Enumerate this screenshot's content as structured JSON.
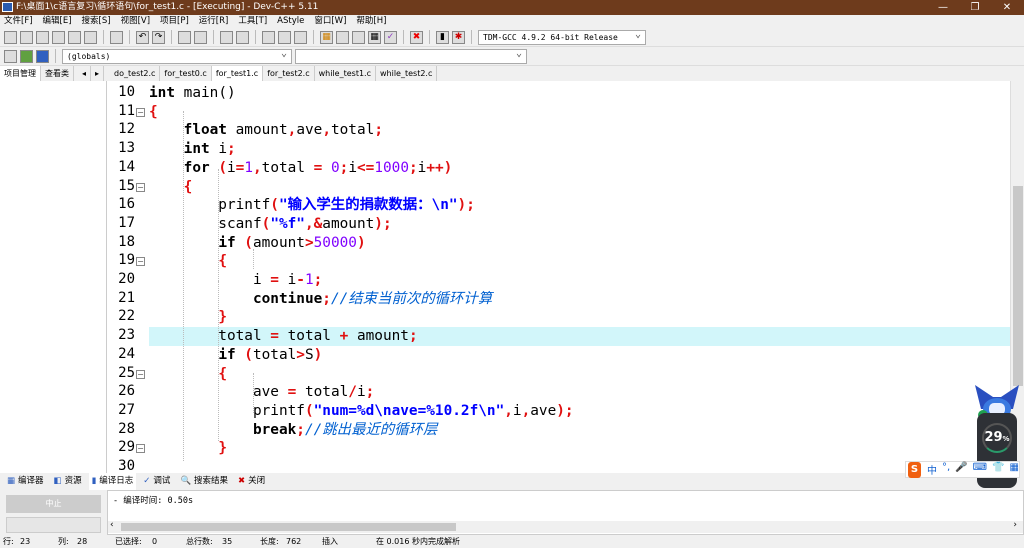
{
  "window": {
    "title": "F:\\桌面1\\c语言复习\\循环语句\\for_test1.c - [Executing] - Dev-C++ 5.11"
  },
  "menu": [
    "文件[F]",
    "编辑[E]",
    "搜索[S]",
    "视图[V]",
    "项目[P]",
    "运行[R]",
    "工具[T]",
    "AStyle",
    "窗口[W]",
    "帮助[H]"
  ],
  "toolbar": {
    "compiler": "TDM-GCC 4.9.2 64-bit Release",
    "scope": "(globals)"
  },
  "left_tabs": [
    "项目管理",
    "查看类"
  ],
  "file_tabs": [
    "do_test2.c",
    "for_test0.c",
    "for_test1.c",
    "for_test2.c",
    "while_test1.c",
    "while_test2.c"
  ],
  "active_file": "for_test1.c",
  "editor": {
    "current_line": 23,
    "fold_lines": [
      11,
      15,
      19,
      25,
      29
    ],
    "lines": [
      {
        "n": "10",
        "t": [
          [
            "int",
            "kw"
          ],
          [
            " main()",
            "id"
          ]
        ]
      },
      {
        "n": "11",
        "t": [
          [
            "{",
            "sym"
          ]
        ]
      },
      {
        "n": "12",
        "t": [
          [
            "    ",
            "id"
          ],
          [
            "float",
            "kw"
          ],
          [
            " amount",
            "id"
          ],
          [
            ",",
            "sym"
          ],
          [
            "ave",
            "id"
          ],
          [
            ",",
            "sym"
          ],
          [
            "total",
            "id"
          ],
          [
            ";",
            "sym"
          ]
        ]
      },
      {
        "n": "13",
        "t": [
          [
            "    ",
            "id"
          ],
          [
            "int",
            "kw"
          ],
          [
            " i",
            "id"
          ],
          [
            ";",
            "sym"
          ]
        ]
      },
      {
        "n": "14",
        "t": [
          [
            "    ",
            "id"
          ],
          [
            "for",
            "kw"
          ],
          [
            " (",
            "sym"
          ],
          [
            "i",
            "id"
          ],
          [
            "=",
            "sym"
          ],
          [
            "1",
            "num"
          ],
          [
            ",",
            "sym"
          ],
          [
            "total ",
            "id"
          ],
          [
            "=",
            "sym"
          ],
          [
            " ",
            "id"
          ],
          [
            "0",
            "num"
          ],
          [
            ";",
            "sym"
          ],
          [
            "i",
            "id"
          ],
          [
            "<=",
            "sym"
          ],
          [
            "1000",
            "num"
          ],
          [
            ";",
            "sym"
          ],
          [
            "i",
            "id"
          ],
          [
            "++)",
            "sym"
          ]
        ]
      },
      {
        "n": "15",
        "t": [
          [
            "    ",
            "id"
          ],
          [
            "{",
            "sym"
          ]
        ]
      },
      {
        "n": "16",
        "t": [
          [
            "        printf",
            "id"
          ],
          [
            "(",
            "sym"
          ],
          [
            "\"输入学生的捐款数据：\\n\"",
            "str"
          ],
          [
            ");",
            "sym"
          ]
        ]
      },
      {
        "n": "17",
        "t": [
          [
            "        scanf",
            "id"
          ],
          [
            "(",
            "sym"
          ],
          [
            "\"%f\"",
            "str"
          ],
          [
            ",&",
            "sym"
          ],
          [
            "amount",
            "id"
          ],
          [
            ");",
            "sym"
          ]
        ]
      },
      {
        "n": "18",
        "t": [
          [
            "        ",
            "id"
          ],
          [
            "if",
            "kw"
          ],
          [
            " (",
            "sym"
          ],
          [
            "amount",
            "id"
          ],
          [
            ">",
            "sym"
          ],
          [
            "50000",
            "num"
          ],
          [
            ")",
            "sym"
          ]
        ]
      },
      {
        "n": "19",
        "t": [
          [
            "        ",
            "id"
          ],
          [
            "{",
            "sym"
          ]
        ]
      },
      {
        "n": "20",
        "t": [
          [
            "            i ",
            "id"
          ],
          [
            "=",
            "sym"
          ],
          [
            " i",
            "id"
          ],
          [
            "-",
            "sym"
          ],
          [
            "1",
            "num"
          ],
          [
            ";",
            "sym"
          ]
        ]
      },
      {
        "n": "21",
        "t": [
          [
            "            ",
            "id"
          ],
          [
            "continue",
            "kw"
          ],
          [
            ";",
            "sym"
          ],
          [
            "//结束当前次的循环计算",
            "cmt"
          ]
        ]
      },
      {
        "n": "22",
        "t": [
          [
            "        ",
            "id"
          ],
          [
            "}",
            "sym"
          ]
        ]
      },
      {
        "n": "23",
        "t": [
          [
            "        total ",
            "id"
          ],
          [
            "=",
            "sym"
          ],
          [
            " total ",
            "id"
          ],
          [
            "+",
            "sym"
          ],
          [
            " amount",
            "id"
          ],
          [
            ";",
            "sym"
          ]
        ]
      },
      {
        "n": "24",
        "t": [
          [
            "        ",
            "id"
          ],
          [
            "if",
            "kw"
          ],
          [
            " (",
            "sym"
          ],
          [
            "total",
            "id"
          ],
          [
            ">",
            "sym"
          ],
          [
            "S",
            "id"
          ],
          [
            ")",
            "sym"
          ]
        ]
      },
      {
        "n": "25",
        "t": [
          [
            "        ",
            "id"
          ],
          [
            "{",
            "sym"
          ]
        ]
      },
      {
        "n": "26",
        "t": [
          [
            "            ave ",
            "id"
          ],
          [
            "=",
            "sym"
          ],
          [
            " total",
            "id"
          ],
          [
            "/",
            "sym"
          ],
          [
            "i",
            "id"
          ],
          [
            ";",
            "sym"
          ]
        ]
      },
      {
        "n": "27",
        "t": [
          [
            "            printf",
            "id"
          ],
          [
            "(",
            "sym"
          ],
          [
            "\"num=%d\\nave=%10.2f\\n\"",
            "str"
          ],
          [
            ",",
            "sym"
          ],
          [
            "i",
            "id"
          ],
          [
            ",",
            "sym"
          ],
          [
            "ave",
            "id"
          ],
          [
            ");",
            "sym"
          ]
        ]
      },
      {
        "n": "28",
        "t": [
          [
            "            ",
            "id"
          ],
          [
            "break",
            "kw"
          ],
          [
            ";",
            "sym"
          ],
          [
            "//跳出最近的循环层",
            "cmt"
          ]
        ]
      },
      {
        "n": "29",
        "t": [
          [
            "        ",
            "id"
          ],
          [
            "}",
            "sym"
          ]
        ]
      },
      {
        "n": "30",
        "t": []
      }
    ]
  },
  "bottom_tabs": [
    "编译器",
    "资源",
    "编译日志",
    "调试",
    "搜索结果",
    "关闭"
  ],
  "active_bottom_tab": "编译日志",
  "abort_button": "中止",
  "log": "- 编译时间: 0.50s",
  "status": {
    "row_label": "行:",
    "row": "23",
    "col_label": "列:",
    "col": "28",
    "sel_label": "已选择:",
    "sel": "0",
    "lines_label": "总行数:",
    "lines": "35",
    "len_label": "长度:",
    "len": "762",
    "mode": "插入",
    "parse": "在 0.016 秒内完成解析"
  },
  "overlay": {
    "percent": "29",
    "percent_unit": "%",
    "ime": [
      "中",
      "°,",
      "🎤",
      "⌨",
      "👕",
      "▦"
    ],
    "ime_logo": "S"
  }
}
